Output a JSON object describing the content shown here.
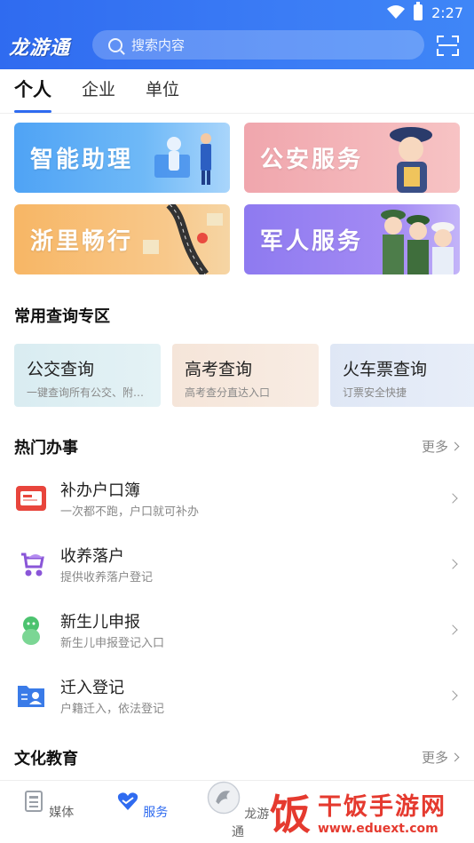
{
  "status": {
    "time": "2:27"
  },
  "header": {
    "logo": "龙游通",
    "search_placeholder": "搜索内容"
  },
  "tabs": [
    {
      "label": "个人",
      "active": true
    },
    {
      "label": "企业",
      "active": false
    },
    {
      "label": "单位",
      "active": false
    }
  ],
  "banners": [
    {
      "label": "智能助理"
    },
    {
      "label": "公安服务"
    },
    {
      "label": "浙里畅行"
    },
    {
      "label": "军人服务"
    }
  ],
  "query_section": {
    "title": "常用查询专区",
    "cards": [
      {
        "title": "公交查询",
        "subtitle": "一键查询所有公交、附…"
      },
      {
        "title": "高考查询",
        "subtitle": "高考查分直达入口"
      },
      {
        "title": "火车票查询",
        "subtitle": "订票安全快捷"
      }
    ]
  },
  "hot_section": {
    "title": "热门办事",
    "more": "更多",
    "items": [
      {
        "title": "补办户口簿",
        "subtitle": "一次都不跑，户口就可补办",
        "icon": "household-register-icon",
        "color": "#e8453c"
      },
      {
        "title": "收养落户",
        "subtitle": "提供收养落户登记",
        "icon": "stroller-icon",
        "color": "#8a56d8"
      },
      {
        "title": "新生儿申报",
        "subtitle": "新生儿申报登记入口",
        "icon": "baby-icon",
        "color": "#4cc36f"
      },
      {
        "title": "迁入登记",
        "subtitle": "户籍迁入，依法登记",
        "icon": "id-card-icon",
        "color": "#3a7be8"
      }
    ]
  },
  "culture_section": {
    "title": "文化教育",
    "more": "更多"
  },
  "bottom_nav": [
    {
      "label": "媒体",
      "icon": "news-icon",
      "active": false
    },
    {
      "label": "服务",
      "icon": "heart-service-icon",
      "active": true
    },
    {
      "label": "龙游通",
      "icon": "dragon-logo-icon",
      "active": false
    }
  ],
  "watermark": {
    "char": "饭",
    "name": "干饭手游网",
    "url": "www.eduext.com"
  },
  "colors": {
    "primary": "#2f6bf0"
  }
}
